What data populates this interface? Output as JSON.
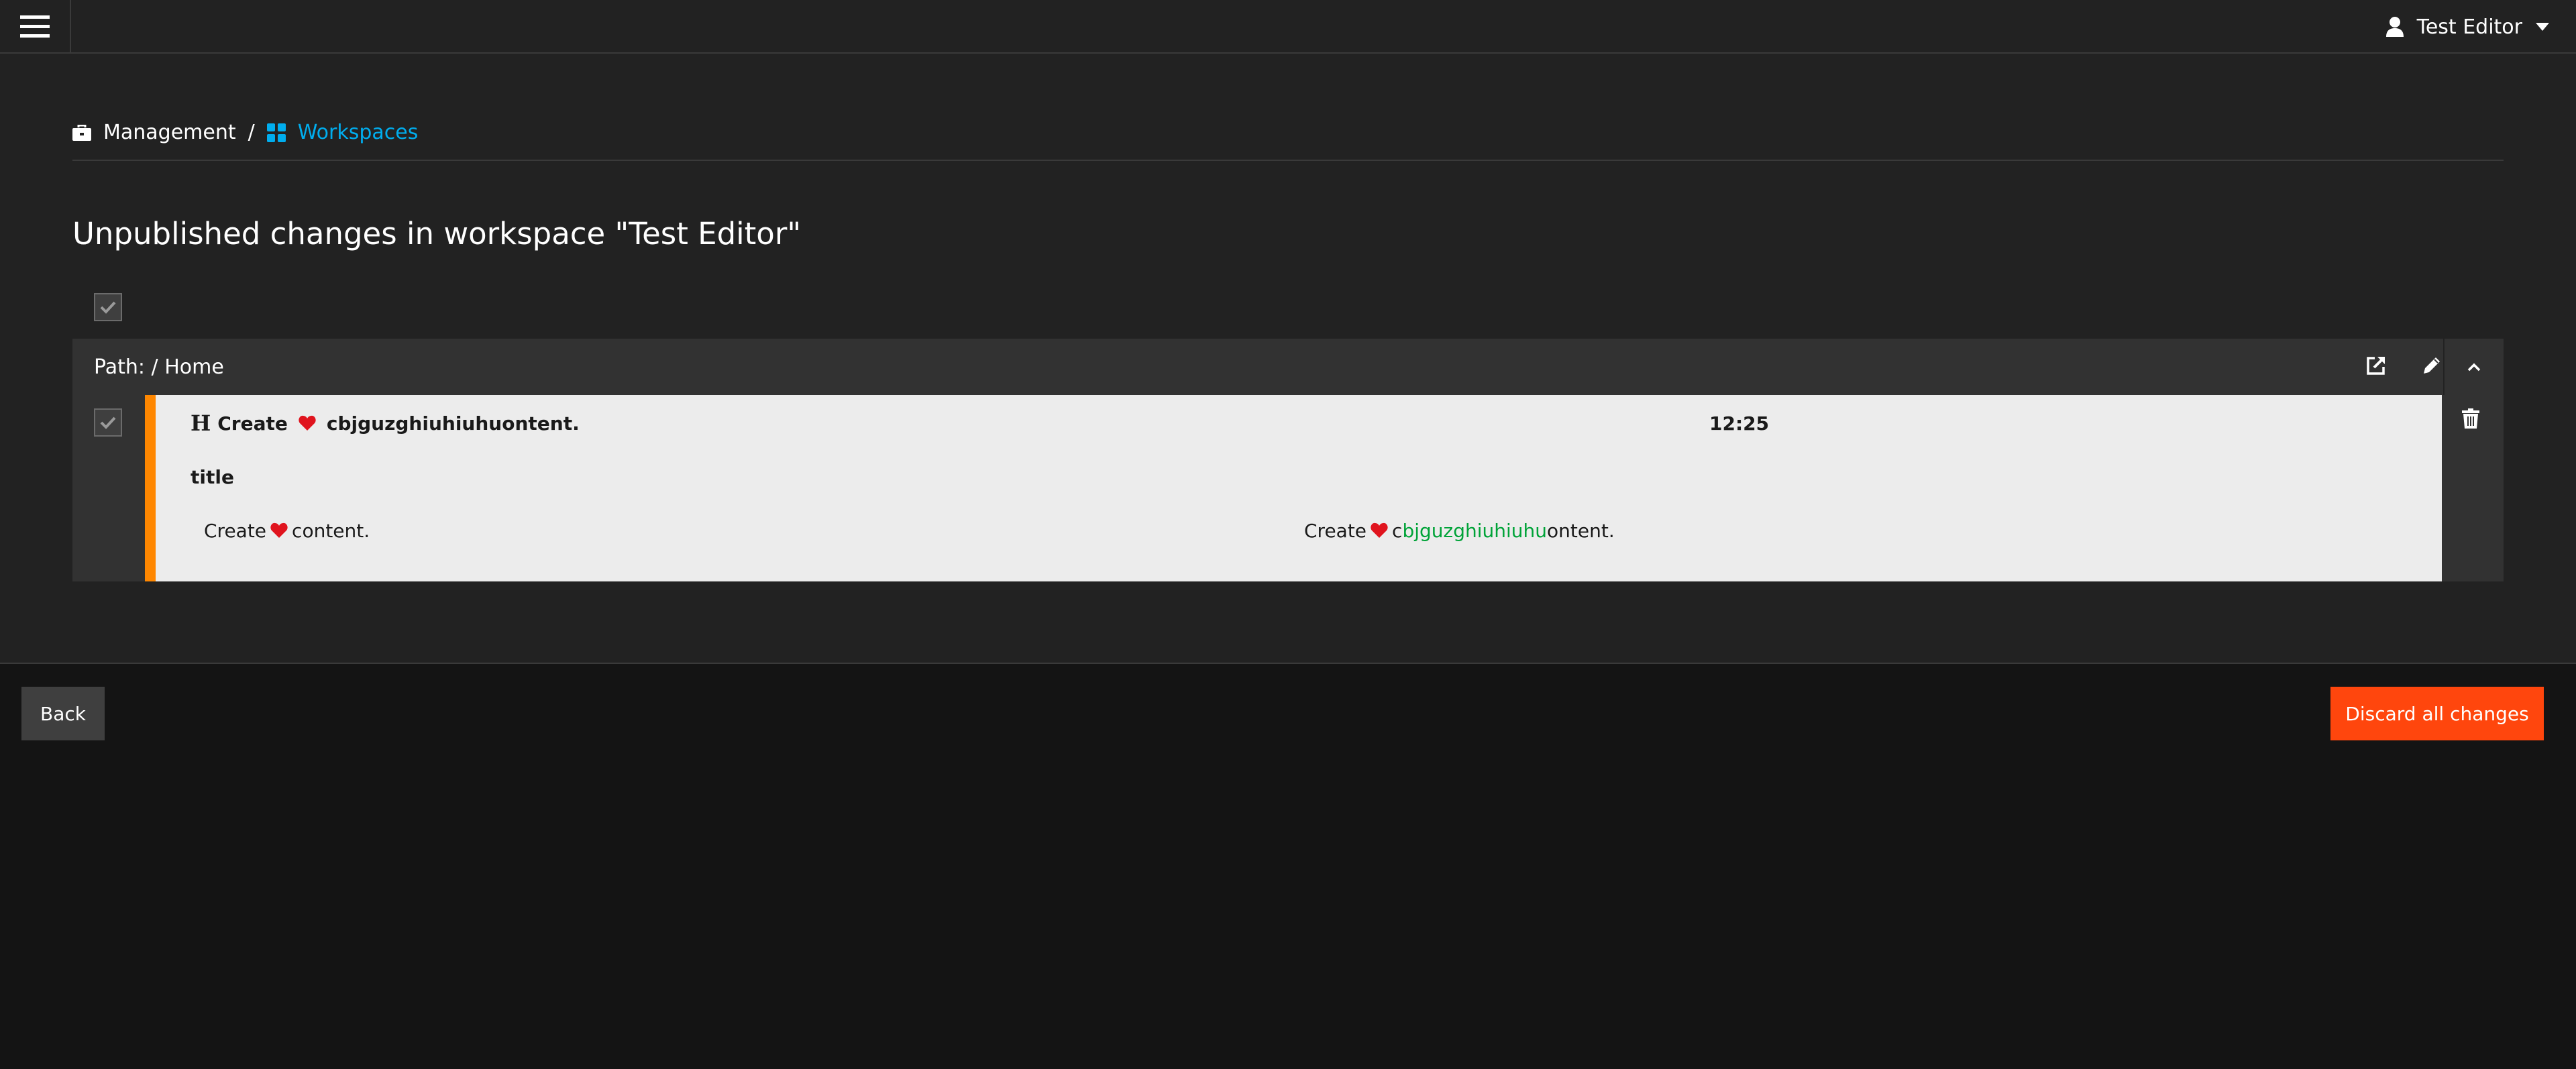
{
  "topbar": {
    "menu_icon": "hamburger-menu-icon",
    "user": {
      "icon": "user-icon",
      "name": "Test Editor",
      "dropdown_icon": "caret-down-icon"
    }
  },
  "breadcrumb": {
    "items": [
      {
        "icon": "briefcase-icon",
        "label": "Management"
      },
      {
        "icon": "th-large-icon",
        "label": "Workspaces"
      }
    ],
    "separator": "/"
  },
  "page": {
    "title": "Unpublished changes in workspace \"Test Editor\""
  },
  "changes": {
    "select_all_checked": true,
    "group": {
      "path_label": "Path: / Home",
      "actions": [
        "external-link-icon",
        "pencil-icon",
        "chevron-up-icon"
      ]
    },
    "item": {
      "checked": true,
      "type_icon": "heading-icon",
      "type_glyph": "H",
      "title_before": "Create",
      "title_after": "cbjguzghiuhiuhuontent.",
      "time": "12:25",
      "property": "title",
      "old_before": "Create",
      "old_after": "content.",
      "new_before": "Create",
      "new_c": "c",
      "new_added": "bjguzghiuhiuhu",
      "new_rest": "ontent.",
      "added_color": "#00a338",
      "status_color": "#ff8700"
    }
  },
  "footer": {
    "back_label": "Back",
    "discard_label": "Discard all changes"
  },
  "colors": {
    "accent_blue": "#00adee",
    "danger": "#ff460d",
    "background": "#222222"
  }
}
